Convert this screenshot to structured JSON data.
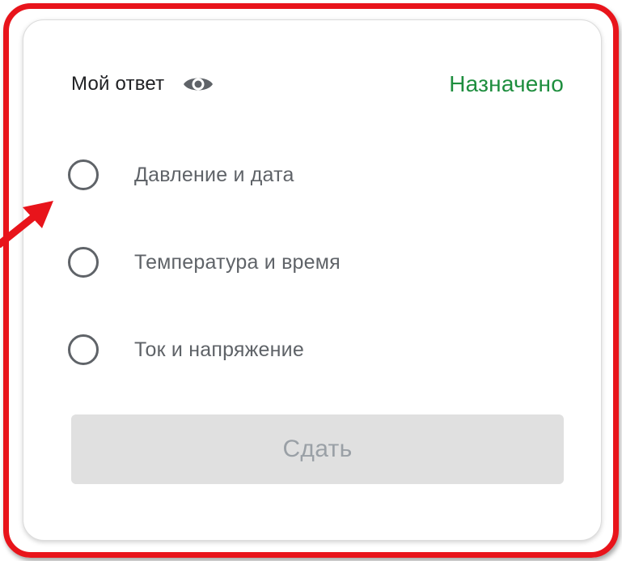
{
  "card": {
    "title": "Мой ответ",
    "title_icon": "eye-icon",
    "status": "Назначено",
    "status_color": "#1e8e3e"
  },
  "options": [
    {
      "label": "Давление и дата",
      "selected": false
    },
    {
      "label": "Температура и время",
      "selected": false
    },
    {
      "label": "Ток и напряжение",
      "selected": false
    }
  ],
  "submit": {
    "label": "Сдать",
    "disabled": true
  },
  "annotation": {
    "frame_color": "#e8141b",
    "arrow_icon": "red-arrow-icon"
  }
}
